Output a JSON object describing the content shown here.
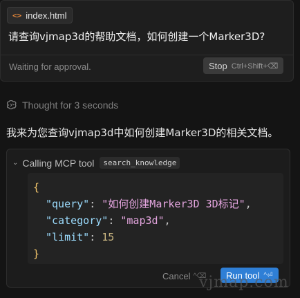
{
  "user_card": {
    "file_chip": {
      "icon": "code-icon",
      "label": "index.html"
    },
    "message": "请查询vjmap3d的帮助文档，如何创建一个Marker3D?",
    "status": "Waiting for approval.",
    "stop_button": {
      "label": "Stop",
      "shortcut": "Ctrl+Shift+⌫"
    }
  },
  "thought": {
    "icon": "brain-icon",
    "text": "Thought for 3 seconds"
  },
  "assistant_message": "我来为您查询vjmap3d中如何创建Marker3D的相关文档。",
  "tool_call": {
    "header": "Calling MCP tool",
    "tool_name": "search_knowledge",
    "args": {
      "open_brace": "{",
      "query_key": "\"query\"",
      "query_value": "\"如何创建Marker3D 3D标记\"",
      "category_key": "\"category\"",
      "category_value": "\"map3d\"",
      "limit_key": "\"limit\"",
      "limit_value": "15",
      "close_brace": "}"
    },
    "cancel_button": {
      "label": "Cancel",
      "shortcut": "^⌫"
    },
    "run_button": {
      "label": "Run tool",
      "shortcut": "^⏎"
    }
  },
  "watermark": "vjmap.com",
  "colors": {
    "accent": "#2f7fd6",
    "file_icon": "#e8883a",
    "background": "#141414"
  }
}
